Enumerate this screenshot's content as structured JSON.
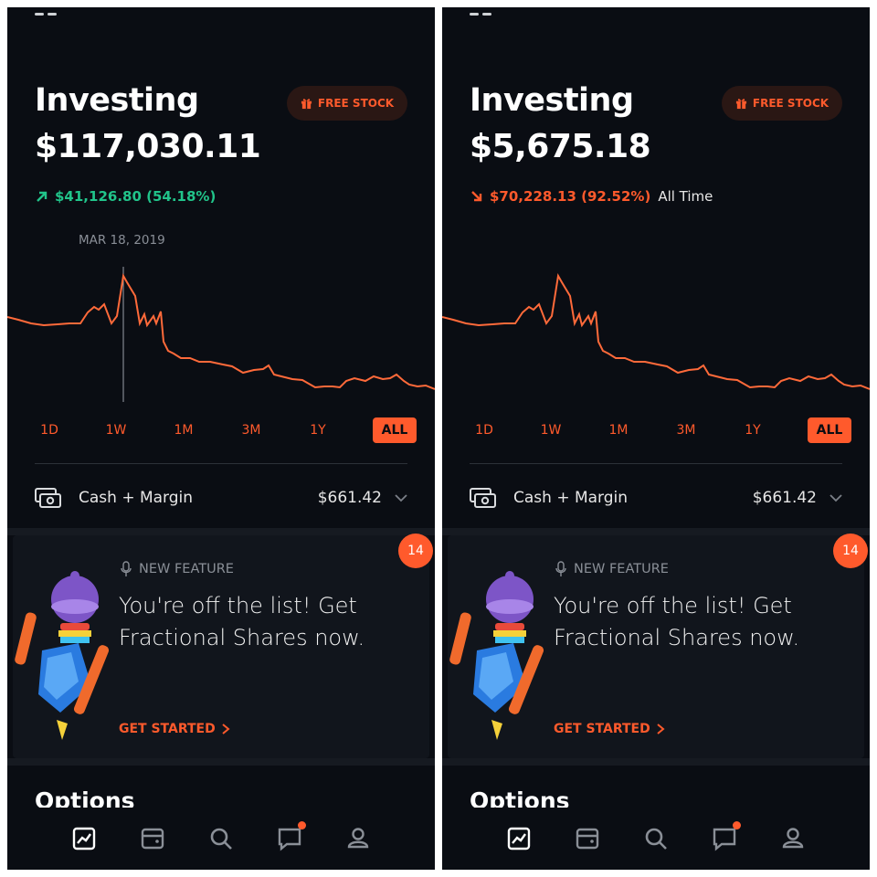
{
  "colors": {
    "background": "#0a0d13",
    "accent": "#ff5a2c",
    "positive": "#21c48a",
    "card": "#11151c"
  },
  "panels": [
    {
      "title": "Investing",
      "portfolio_value": "$117,030.11",
      "free_stock_label": "FREE STOCK",
      "change": {
        "direction": "up",
        "text": "$41,126.80 (54.18%)",
        "suffix": ""
      },
      "hover_date": "MAR 18, 2019",
      "ranges": [
        "1D",
        "1W",
        "1M",
        "3M",
        "1Y",
        "ALL"
      ],
      "active_range": "ALL",
      "cash": {
        "label": "Cash + Margin",
        "value": "$661.42"
      },
      "card": {
        "badge": "14",
        "tag": "NEW FEATURE",
        "headline": "You're off the list! Get Fractional Shares now.",
        "cta": "GET STARTED"
      },
      "next_section": "Options",
      "nav": [
        "chart-icon",
        "wallet-icon",
        "search-icon",
        "messages-icon",
        "account-icon"
      ]
    },
    {
      "title": "Investing",
      "portfolio_value": "$5,675.18",
      "free_stock_label": "FREE STOCK",
      "change": {
        "direction": "down",
        "text": "$70,228.13 (92.52%)",
        "suffix": "All Time"
      },
      "hover_date": "",
      "ranges": [
        "1D",
        "1W",
        "1M",
        "3M",
        "1Y",
        "ALL"
      ],
      "active_range": "ALL",
      "cash": {
        "label": "Cash + Margin",
        "value": "$661.42"
      },
      "card": {
        "badge": "14",
        "tag": "NEW FEATURE",
        "headline": "You're off the list! Get Fractional Shares now.",
        "cta": "GET STARTED"
      },
      "next_section": "Options",
      "nav": [
        "chart-icon",
        "wallet-icon",
        "search-icon",
        "messages-icon",
        "account-icon"
      ]
    }
  ]
}
